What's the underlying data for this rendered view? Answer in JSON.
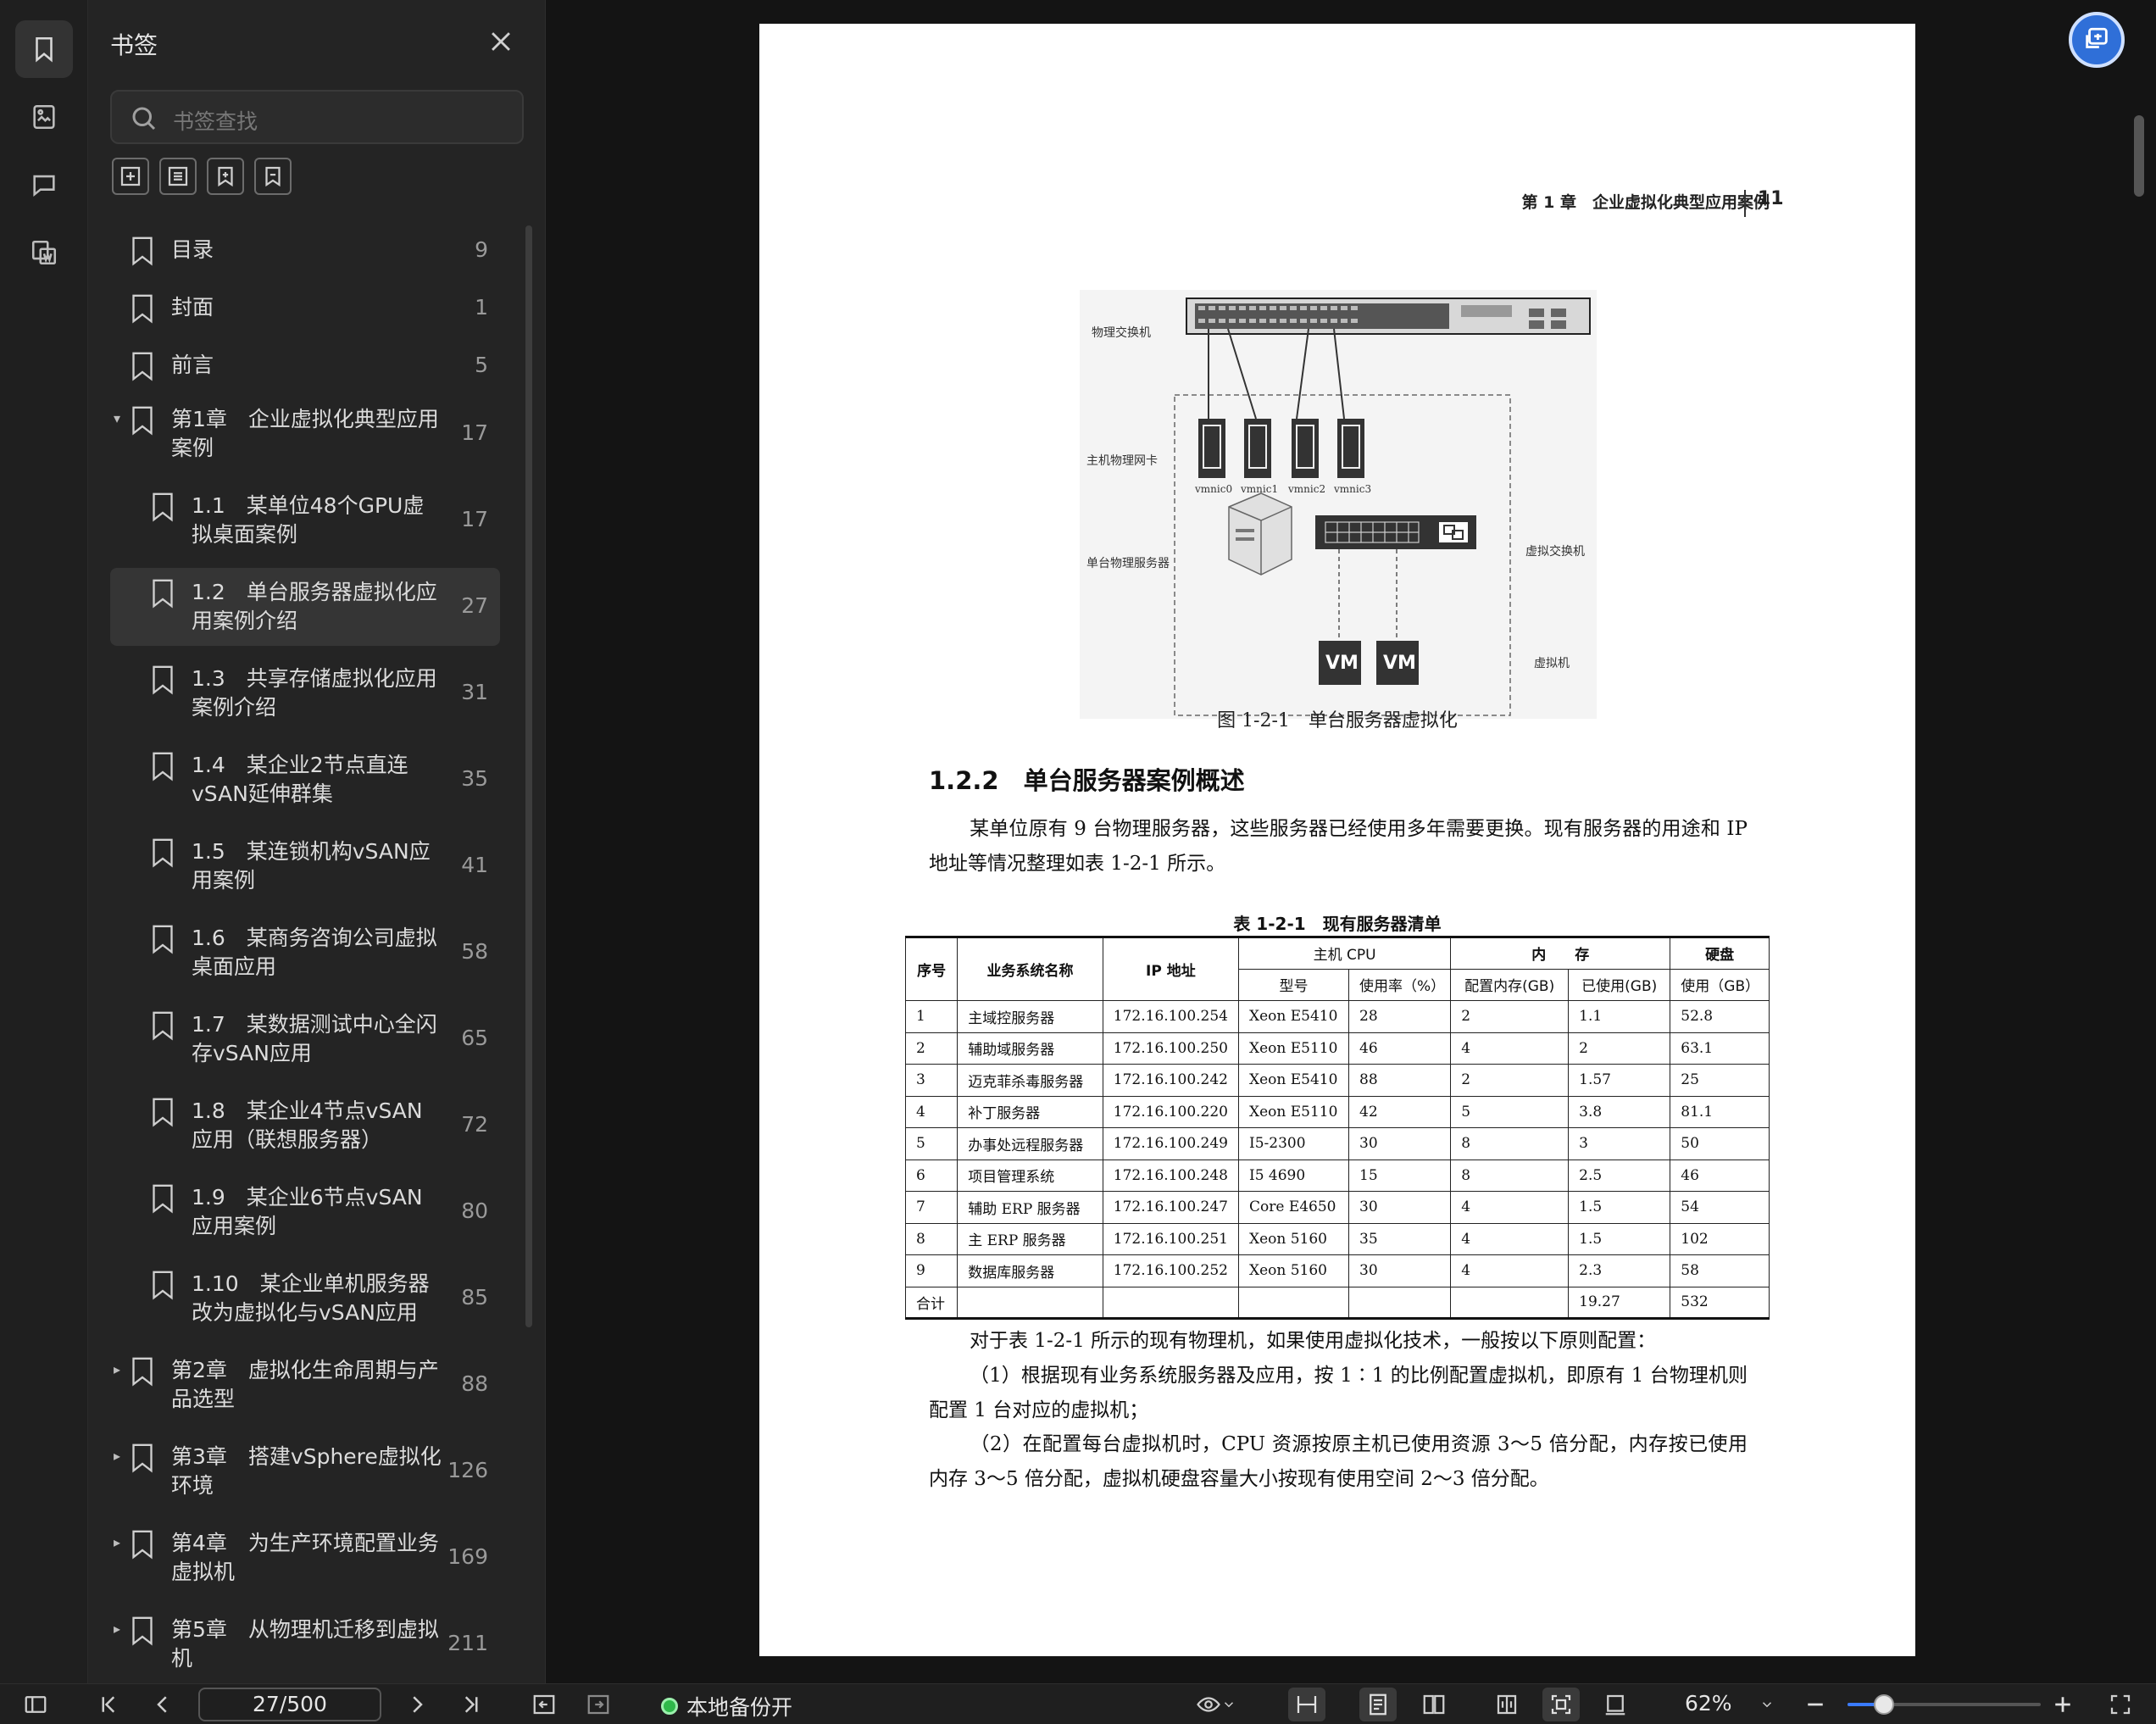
{
  "rail": {
    "items": [
      {
        "icon": "bookmark-icon",
        "active": true
      },
      {
        "icon": "image-icon",
        "active": false
      },
      {
        "icon": "comment-icon",
        "active": false
      },
      {
        "icon": "word-export-icon",
        "active": false
      }
    ]
  },
  "panel": {
    "title": "书签",
    "search_placeholder": "书签查找",
    "tools": [
      "add-bookmark-icon",
      "remove-bookmark-icon",
      "expand-bookmark-icon",
      "collapse-bookmark-icon"
    ]
  },
  "bookmarks": [
    {
      "label": "目录",
      "page": "9",
      "level": 0,
      "expand": ""
    },
    {
      "label": "封面",
      "page": "1",
      "level": 0,
      "expand": ""
    },
    {
      "label": "前言",
      "page": "5",
      "level": 0,
      "expand": ""
    },
    {
      "label": "第1章　企业虚拟化典型应用案例",
      "page": "17",
      "level": 0,
      "expand": "open"
    },
    {
      "label": "1.1　某单位48个GPU虚拟桌面案例",
      "page": "17",
      "level": 1,
      "expand": ""
    },
    {
      "label": "1.2　单台服务器虚拟化应用案例介绍",
      "page": "27",
      "level": 1,
      "expand": "",
      "selected": true
    },
    {
      "label": "1.3　共享存储虚拟化应用案例介绍",
      "page": "31",
      "level": 1,
      "expand": ""
    },
    {
      "label": "1.4　某企业2节点直连vSAN延伸群集",
      "page": "35",
      "level": 1,
      "expand": ""
    },
    {
      "label": "1.5　某连锁机构vSAN应用案例",
      "page": "41",
      "level": 1,
      "expand": ""
    },
    {
      "label": "1.6　某商务咨询公司虚拟桌面应用",
      "page": "58",
      "level": 1,
      "expand": ""
    },
    {
      "label": "1.7　某数据测试中心全闪存vSAN应用",
      "page": "65",
      "level": 1,
      "expand": ""
    },
    {
      "label": "1.8　某企业4节点vSAN应用（联想服务器）",
      "page": "72",
      "level": 1,
      "expand": ""
    },
    {
      "label": "1.9　某企业6节点vSAN应用案例",
      "page": "80",
      "level": 1,
      "expand": ""
    },
    {
      "label": "1.10　某企业单机服务器改为虚拟化与vSAN应用",
      "page": "85",
      "level": 1,
      "expand": ""
    },
    {
      "label": "第2章　虚拟化生命周期与产品选型",
      "page": "88",
      "level": 0,
      "expand": "closed"
    },
    {
      "label": "第3章　搭建vSphere虚拟化环境",
      "page": "126",
      "level": 0,
      "expand": "closed"
    },
    {
      "label": "第4章　为生产环境配置业务虚拟机",
      "page": "169",
      "level": 0,
      "expand": "closed"
    },
    {
      "label": "第5章　从物理机迁移到虚拟机",
      "page": "211",
      "level": 0,
      "expand": "closed"
    }
  ],
  "page": {
    "running_head": "第 1 章　企业虚拟化典型应用案例",
    "page_number": "11",
    "figure": {
      "labels": {
        "switch": "物理交换机",
        "nic": "主机物理网卡",
        "server": "单台物理服务器",
        "vswitch": "虚拟交换机",
        "vm": "虚拟机"
      },
      "nics": [
        "vmnic0",
        "vmnic1",
        "vmnic2",
        "vmnic3"
      ],
      "vm_labels": [
        "VM",
        "VM"
      ],
      "caption": "图 1-2-1　单台服务器虚拟化"
    },
    "section_title": "1.2.2　单台服务器案例概述",
    "para1": "某单位原有 9 台物理服务器，这些服务器已经使用多年需要更换。现有服务器的用途和 IP 地址等情况整理如表 1-2-1 所示。",
    "table": {
      "caption": "表 1-2-1　现有服务器清单",
      "head_top": [
        "序号",
        "业务系统名称",
        "IP 地址",
        "主机 CPU",
        "内　　存",
        "硬盘"
      ],
      "head_sub": [
        "型号",
        "使用率（%）",
        "配置内存(GB)",
        "已使用(GB)",
        "使用（GB）"
      ],
      "rows": [
        [
          "1",
          "主域控服务器",
          "172.16.100.254",
          "Xeon E5410",
          "28",
          "2",
          "1.1",
          "52.8"
        ],
        [
          "2",
          "辅助域服务器",
          "172.16.100.250",
          "Xeon E5110",
          "46",
          "4",
          "2",
          "63.1"
        ],
        [
          "3",
          "迈克菲杀毒服务器",
          "172.16.100.242",
          "Xeon E5410",
          "88",
          "2",
          "1.57",
          "25"
        ],
        [
          "4",
          "补丁服务器",
          "172.16.100.220",
          "Xeon E5110",
          "42",
          "5",
          "3.8",
          "81.1"
        ],
        [
          "5",
          "办事处远程服务器",
          "172.16.100.249",
          "I5-2300",
          "30",
          "8",
          "3",
          "50"
        ],
        [
          "6",
          "项目管理系统",
          "172.16.100.248",
          "I5 4690",
          "15",
          "8",
          "2.5",
          "46"
        ],
        [
          "7",
          "辅助 ERP 服务器",
          "172.16.100.247",
          "Core E4650",
          "30",
          "4",
          "1.5",
          "54"
        ],
        [
          "8",
          "主 ERP 服务器",
          "172.16.100.251",
          "Xeon 5160",
          "35",
          "4",
          "1.5",
          "102"
        ],
        [
          "9",
          "数据库服务器",
          "172.16.100.252",
          "Xeon 5160",
          "30",
          "4",
          "2.3",
          "58"
        ],
        [
          "合计",
          "",
          "",
          "",
          "",
          "",
          "19.27",
          "532"
        ]
      ]
    },
    "para2": "对于表 1-2-1 所示的现有物理机，如果使用虚拟化技术，一般按以下原则配置：",
    "para3": "（1）根据现有业务系统服务器及应用，按 1∶1 的比例配置虚拟机，即原有 1 台物理机则配置 1 台对应的虚拟机；",
    "para4": "（2）在配置每台虚拟机时，CPU 资源按原主机已使用资源 3～5 倍分配，内存按已使用内存 3～5 倍分配，虚拟机硬盘容量大小按现有使用空间 2～3 倍分配。"
  },
  "bottombar": {
    "page_indicator": "27/500",
    "backup_label": "本地备份开",
    "zoom": "62%",
    "zoom_slider_fraction": 0.19
  },
  "colors": {
    "accent": "#3a7bff",
    "panel_bg": "#242424",
    "selected_bg": "#353535",
    "fab": "#2f6fd8",
    "backup_dot": "#2fb84a"
  }
}
